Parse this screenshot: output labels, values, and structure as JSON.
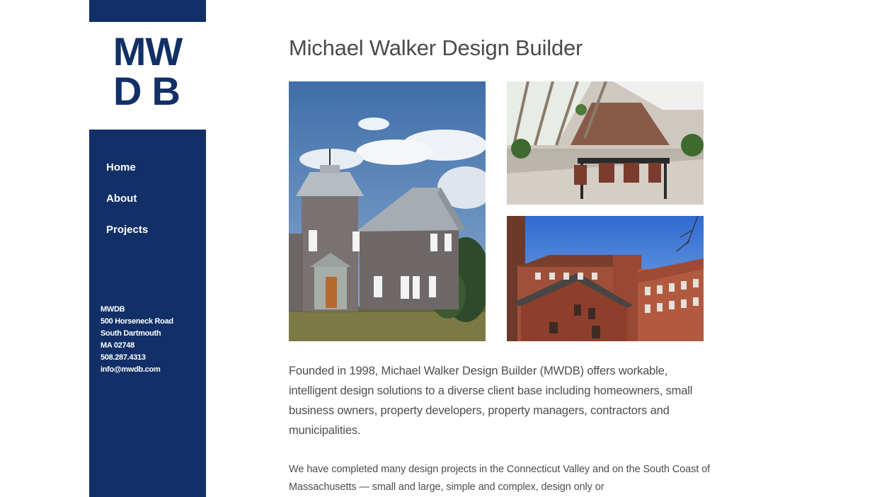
{
  "logo": {
    "line1": "MW",
    "line2": "DB",
    "color": "#123067"
  },
  "nav": {
    "items": [
      {
        "label": "Home"
      },
      {
        "label": "About"
      },
      {
        "label": "Projects"
      }
    ]
  },
  "contact": {
    "name": "MWDB",
    "street": "500 Horseneck Road",
    "city": "South Dartmouth",
    "state_zip": "MA 02748",
    "phone": "508.287.4313",
    "email": "info@mwdb.com"
  },
  "main": {
    "title": "Michael Walker Design Builder",
    "paragraph1": "Founded in 1998, Michael Walker Design Builder (MWDB) offers workable, intelligent design solutions to a diverse client base including homeowners, small business owners, property developers, property managers, contractors and municipalities.",
    "paragraph2": "We have completed many design projects in the Connecticut Valley and on the South Coast of Massachusetts — small and large, simple and complex, design only or"
  },
  "images": [
    {
      "name": "shingled-house-with-tower"
    },
    {
      "name": "loft-dining-interior"
    },
    {
      "name": "brick-mill-building"
    }
  ],
  "colors": {
    "sidebar": "#123067",
    "text": "#4d4d4d",
    "title": "#4a4a4a"
  }
}
